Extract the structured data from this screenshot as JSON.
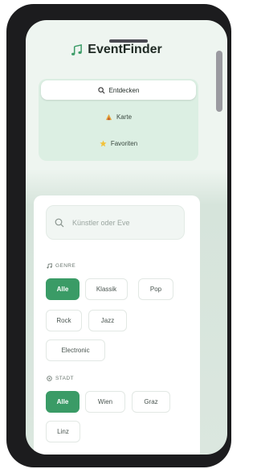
{
  "app": {
    "title": "EventFinder",
    "accent_color": "#3a9b66"
  },
  "nav": {
    "items": [
      {
        "label": "Entdecken",
        "icon": "search-icon",
        "active": true
      },
      {
        "label": "Karte",
        "icon": "map-icon",
        "active": false
      },
      {
        "label": "Favoriten",
        "icon": "star-icon",
        "active": false
      }
    ]
  },
  "search": {
    "placeholder": "Künstler oder Eve",
    "value": ""
  },
  "filters": {
    "genre": {
      "label": "GENRE",
      "icon": "music-note-icon",
      "options": [
        "Alle",
        "Klassik",
        "Pop",
        "Rock",
        "Jazz",
        "Electronic"
      ],
      "selected": "Alle"
    },
    "city": {
      "label": "STADT",
      "icon": "location-pin-icon",
      "options": [
        "Alle",
        "Wien",
        "Graz",
        "Linz"
      ],
      "selected": "Alle"
    }
  }
}
